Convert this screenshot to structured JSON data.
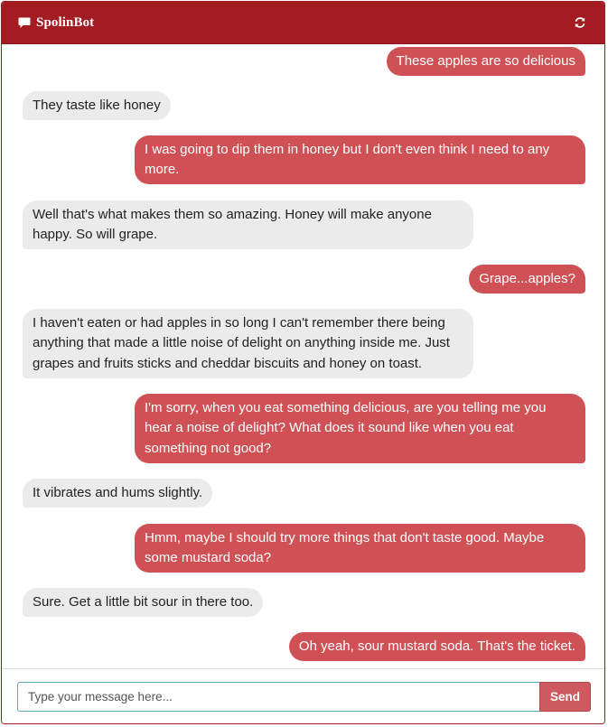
{
  "app": {
    "title": "SpolinBot",
    "icon": "chat-bubble-icon",
    "refresh_icon": "refresh-icon"
  },
  "colors": {
    "header": "#a31c22",
    "user_bubble": "#d05155",
    "bot_bubble": "#ebebeb",
    "send_button": "#cc5a5f"
  },
  "messages": [
    {
      "sender": "user",
      "text": "These apples are so delicious"
    },
    {
      "sender": "bot",
      "text": "They taste like honey"
    },
    {
      "sender": "user",
      "text": "I was going to dip them in honey but I don't even think I need to any more."
    },
    {
      "sender": "bot",
      "text": "Well that's what makes them so amazing. Honey will make anyone happy. So will grape."
    },
    {
      "sender": "user",
      "text": "Grape...apples?"
    },
    {
      "sender": "bot",
      "text": "I haven't eaten or had apples in so long I can't remember there being anything that made a little noise of delight on anything inside me. Just grapes and fruits sticks and cheddar biscuits and honey on toast."
    },
    {
      "sender": "user",
      "text": "I'm sorry, when you eat something delicious, are you telling me you hear a noise of delight? What does it sound like when you eat something not good?"
    },
    {
      "sender": "bot",
      "text": "It vibrates and hums slightly."
    },
    {
      "sender": "user",
      "text": "Hmm, maybe I should try more things that don't taste good. Maybe some mustard soda?"
    },
    {
      "sender": "bot",
      "text": "Sure. Get a little bit sour in there too."
    },
    {
      "sender": "user",
      "text": "Oh yeah, sour mustard soda. That's the ticket."
    }
  ],
  "composer": {
    "placeholder": "Type your message here...",
    "value": "",
    "send_label": "Send"
  }
}
